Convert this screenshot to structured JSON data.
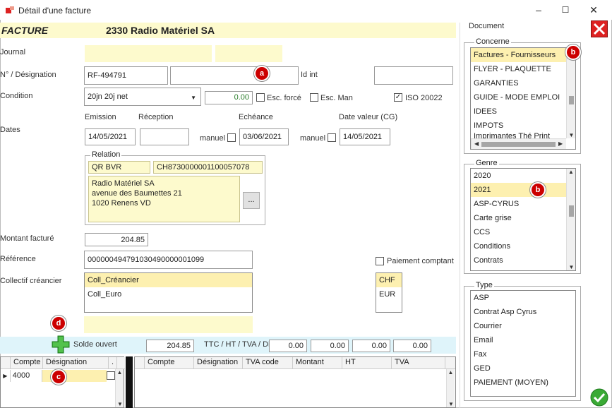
{
  "window": {
    "title": "Détail d'une facture",
    "minimize": "–",
    "maximize": "☐",
    "close": "✕"
  },
  "header": {
    "doc_type": "FACTURE",
    "supplier": "2330 Radio Matériel SA"
  },
  "labels": {
    "journal": "Journal",
    "numero": "N° / Désignation",
    "id_int": "Id int",
    "condition": "Condition",
    "dates": "Dates",
    "emission": "Emission",
    "reception": "Réception",
    "echeance": "Echéance",
    "date_valeur": "Date valeur (CG)",
    "manuel": "manuel",
    "relation": "Relation",
    "montant": "Montant facturé",
    "reference": "Référence",
    "collectif": "Collectif créancier",
    "esc_force": "Esc. forcé",
    "esc_man": "Esc. Man",
    "iso": "ISO 20022",
    "paiement_comptant": "Paiement comptant",
    "solde_ouvert": "Solde ouvert",
    "totals_label": "TTC / HT / TVA / Di",
    "relation_btn": "..."
  },
  "fields": {
    "numero": "RF-494791",
    "designation": "",
    "id_int": "",
    "condition": "20jn 20j net",
    "escompte": "0.00",
    "emission": "14/05/2021",
    "reception": "",
    "echeance": "03/06/2021",
    "date_valeur": "14/05/2021",
    "qr": "QR BVR",
    "iban": "CH8730000001100057078",
    "address": [
      "Radio Matériel SA",
      "avenue des Baumettes 21",
      "1020 Renens VD"
    ],
    "montant": "204.85",
    "reference": "000000494791030490000001099",
    "solde": "204.85",
    "ttc": "0.00",
    "ht": "0.00",
    "tva": "0.00",
    "di": "0.00"
  },
  "checks": {
    "esc_force": false,
    "esc_man": false,
    "iso": true,
    "paiement_comptant": false
  },
  "collectif": [
    "Coll_Créancier",
    "Coll_Euro"
  ],
  "currencies": [
    "CHF",
    "EUR"
  ],
  "badges": {
    "a": "a",
    "b": "b",
    "c": "c",
    "d": "d"
  },
  "document": {
    "title": "Document",
    "concerne_title": "Concerne",
    "concerne": [
      "Factures - Fournisseurs",
      "FLYER - PLAQUETTE",
      "GARANTIES",
      "GUIDE - MODE EMPLOI",
      "IDEES",
      "IMPOTS",
      "Imprimantes Thé Print"
    ],
    "genre_title": "Genre",
    "genre": [
      "2020",
      "2021",
      "ASP-CYRUS",
      "Carte grise",
      "CCS",
      "Conditions",
      "Contrats"
    ],
    "type_title": "Type",
    "type": [
      "ASP",
      "Contrat Asp Cyrus",
      "Courrier",
      "Email",
      "Fax",
      "GED",
      "PAIEMENT (MOYEN)"
    ]
  },
  "grid_left": {
    "headers": [
      "Compte",
      "Désignation",
      "."
    ],
    "rows": [
      {
        "compte": "4000",
        "designation": ""
      }
    ]
  },
  "grid_right": {
    "headers": [
      "Compte",
      "Désignation",
      "TVA code",
      "Montant",
      "HT",
      "TVA"
    ]
  }
}
